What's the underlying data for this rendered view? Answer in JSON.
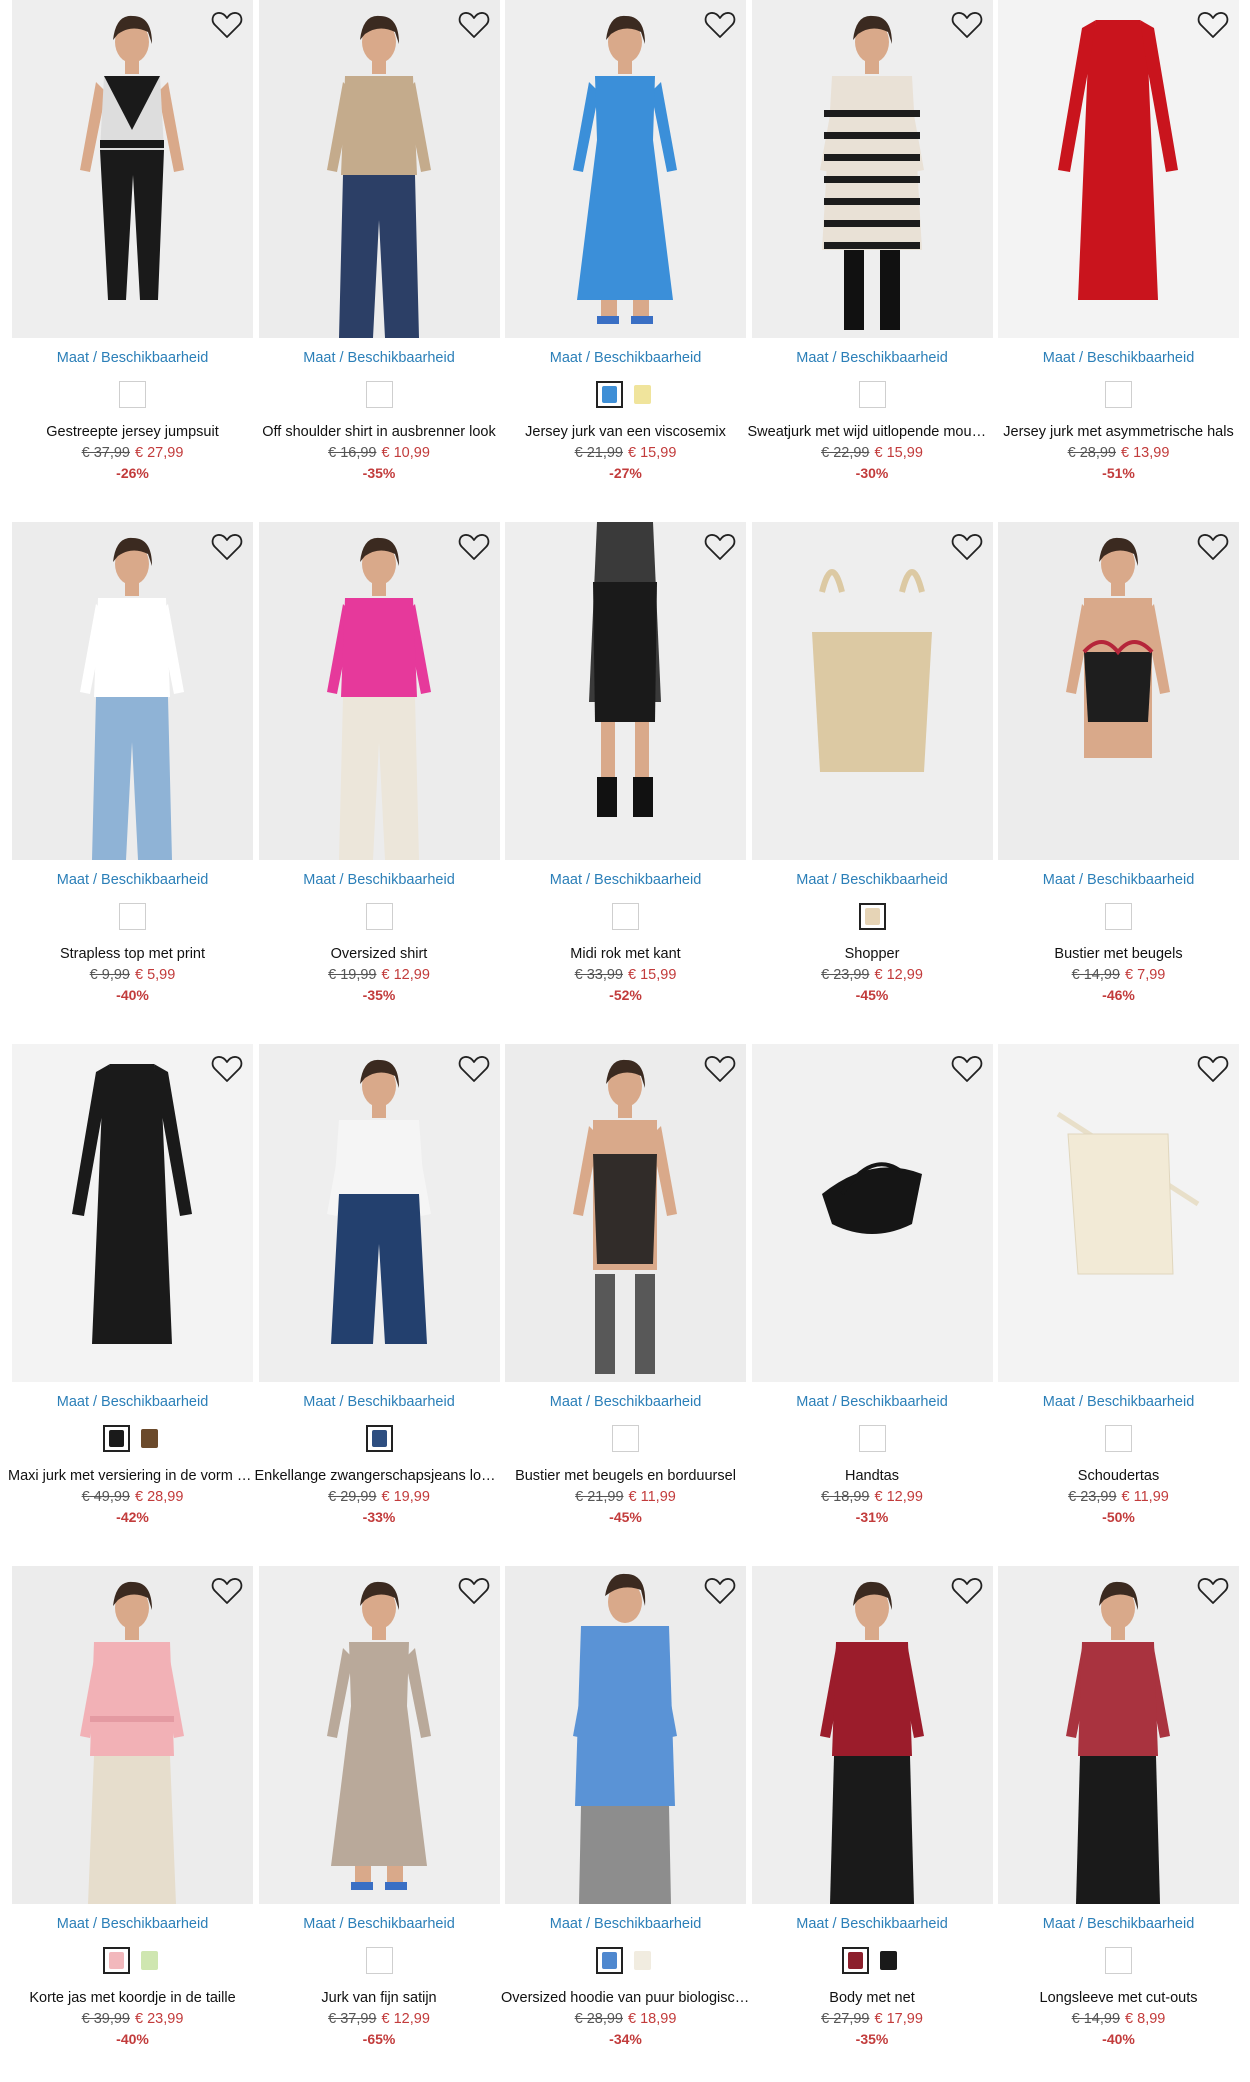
{
  "size_link_label": "Maat / Beschikbaarheid",
  "colors": {
    "accent": "#2b7fb8",
    "sale": "#c23b3b"
  },
  "products": [
    {
      "name": "Gestreepte jersey jumpsuit",
      "old_price": "€ 37,99",
      "price": "€ 27,99",
      "discount": "-26%",
      "swatches": [
        "#ffffff"
      ],
      "icon": "jumpsuit",
      "bg": "#eeeeee",
      "c1": "#1a1a1a",
      "c2": "#dddddd"
    },
    {
      "name": "Off shoulder shirt in ausbrenner look",
      "old_price": "€ 16,99",
      "price": "€ 10,99",
      "discount": "-35%",
      "swatches": [
        "#ffffff"
      ],
      "icon": "top-jeans",
      "bg": "#ececec",
      "c1": "#c4ab8c",
      "c2": "#2c3f66"
    },
    {
      "name": "Jersey jurk van een viscosemix",
      "old_price": "€ 21,99",
      "price": "€ 15,99",
      "discount": "-27%",
      "swatches": [
        "#3f8fd6",
        "#f0e49c"
      ],
      "icon": "dress",
      "bg": "#eeeeee",
      "c1": "#3b8fd9",
      "c2": "#3b8fd9"
    },
    {
      "name": "Sweatjurk met wijd uitlopende mouwen",
      "old_price": "€ 22,99",
      "price": "€ 15,99",
      "discount": "-30%",
      "swatches": [
        "#ffffff"
      ],
      "icon": "dress-stripe",
      "bg": "#eeeeee",
      "c1": "#e9e1d6",
      "c2": "#1c1c1c"
    },
    {
      "name": "Jersey jurk met asymmetrische hals",
      "old_price": "€ 28,99",
      "price": "€ 13,99",
      "discount": "-51%",
      "swatches": [
        "#ffffff"
      ],
      "icon": "dress-flat",
      "bg": "#f3f3f3",
      "c1": "#c9141d",
      "c2": "#c9141d"
    },
    {
      "name": "Strapless top met print",
      "old_price": "€ 9,99",
      "price": "€ 5,99",
      "discount": "-40%",
      "swatches": [
        "#ffffff"
      ],
      "icon": "top-jeans",
      "bg": "#ececec",
      "c1": "#ffffff",
      "c2": "#8fb3d6"
    },
    {
      "name": "Oversized shirt",
      "old_price": "€ 19,99",
      "price": "€ 12,99",
      "discount": "-35%",
      "swatches": [
        "#ffffff"
      ],
      "icon": "top-jeans",
      "bg": "#ececec",
      "c1": "#e6399b",
      "c2": "#ece6da"
    },
    {
      "name": "Midi rok met kant",
      "old_price": "€ 33,99",
      "price": "€ 15,99",
      "discount": "-52%",
      "swatches": [
        "#ffffff"
      ],
      "icon": "skirt",
      "bg": "#eeeeee",
      "c1": "#1a1a1a",
      "c2": "#1a1a1a"
    },
    {
      "name": "Shopper",
      "old_price": "€ 23,99",
      "price": "€ 12,99",
      "discount": "-45%",
      "swatches": [
        "#e6d4b6"
      ],
      "icon": "tote",
      "bg": "#eeeeee",
      "c1": "#dcc9a3",
      "c2": "#dcc9a3"
    },
    {
      "name": "Bustier met beugels",
      "old_price": "€ 14,99",
      "price": "€ 7,99",
      "discount": "-46%",
      "swatches": [
        "#ffffff"
      ],
      "icon": "bustier",
      "bg": "#ececec",
      "c1": "#1e1e1e",
      "c2": "#b5263a"
    },
    {
      "name": "Maxi jurk met versiering in de vorm van studs",
      "old_price": "€ 49,99",
      "price": "€ 28,99",
      "discount": "-42%",
      "swatches": [
        "#1a1a1a",
        "#6b4a2b"
      ],
      "icon": "dress-flat",
      "bg": "#f3f3f3",
      "c1": "#1a1a1a",
      "c2": "#1a1a1a"
    },
    {
      "name": "Enkellange zwangerschapsjeans loose fit",
      "old_price": "€ 29,99",
      "price": "€ 19,99",
      "discount": "-33%",
      "swatches": [
        "#2d4e80"
      ],
      "icon": "jeans",
      "bg": "#eeeeee",
      "c1": "#f5f5f5",
      "c2": "#23406e"
    },
    {
      "name": "Bustier met beugels en borduursel",
      "old_price": "€ 21,99",
      "price": "€ 11,99",
      "discount": "-45%",
      "swatches": [
        "#ffffff"
      ],
      "icon": "lingerie",
      "bg": "#ececec",
      "c1": "#1e1e1e",
      "c2": "#1e1e1e"
    },
    {
      "name": "Handtas",
      "old_price": "€ 18,99",
      "price": "€ 12,99",
      "discount": "-31%",
      "swatches": [
        "#ffffff"
      ],
      "icon": "handbag",
      "bg": "#f1f1f1",
      "c1": "#151515",
      "c2": "#151515"
    },
    {
      "name": "Schoudertas",
      "old_price": "€ 23,99",
      "price": "€ 11,99",
      "discount": "-50%",
      "swatches": [
        "#ffffff"
      ],
      "icon": "shoulderbag",
      "bg": "#f3f3f3",
      "c1": "#f2ead6",
      "c2": "#f2ead6"
    },
    {
      "name": "Korte jas met koordje in de taille",
      "old_price": "€ 39,99",
      "price": "€ 23,99",
      "discount": "-40%",
      "swatches": [
        "#f2b8bc",
        "#cfe6b0"
      ],
      "icon": "jacket",
      "bg": "#ececec",
      "c1": "#f2b1b6",
      "c2": "#e6ddcc"
    },
    {
      "name": "Jurk van fijn satijn",
      "old_price": "€ 37,99",
      "price": "€ 12,99",
      "discount": "-65%",
      "swatches": [
        "#ffffff"
      ],
      "icon": "dress",
      "bg": "#eeeeee",
      "c1": "#b9a99a",
      "c2": "#b9a99a"
    },
    {
      "name": "Oversized hoodie van puur biologisch katoen",
      "old_price": "€ 28,99",
      "price": "€ 18,99",
      "discount": "-34%",
      "swatches": [
        "#4f88cf",
        "#f1ece0"
      ],
      "icon": "hoodie",
      "bg": "#ececec",
      "c1": "#5a93d6",
      "c2": "#8d8d8d"
    },
    {
      "name": "Body met net",
      "old_price": "€ 27,99",
      "price": "€ 17,99",
      "discount": "-35%",
      "swatches": [
        "#8c1f2c",
        "#1a1a1a"
      ],
      "icon": "top-dark",
      "bg": "#eeeeee",
      "c1": "#9b1c2b",
      "c2": "#1a1a1a"
    },
    {
      "name": "Longsleeve met cut-outs",
      "old_price": "€ 14,99",
      "price": "€ 8,99",
      "discount": "-40%",
      "swatches": [
        "#ffffff"
      ],
      "icon": "top-dark",
      "bg": "#eeeeee",
      "c1": "#a9333f",
      "c2": "#1a1a1a"
    }
  ]
}
